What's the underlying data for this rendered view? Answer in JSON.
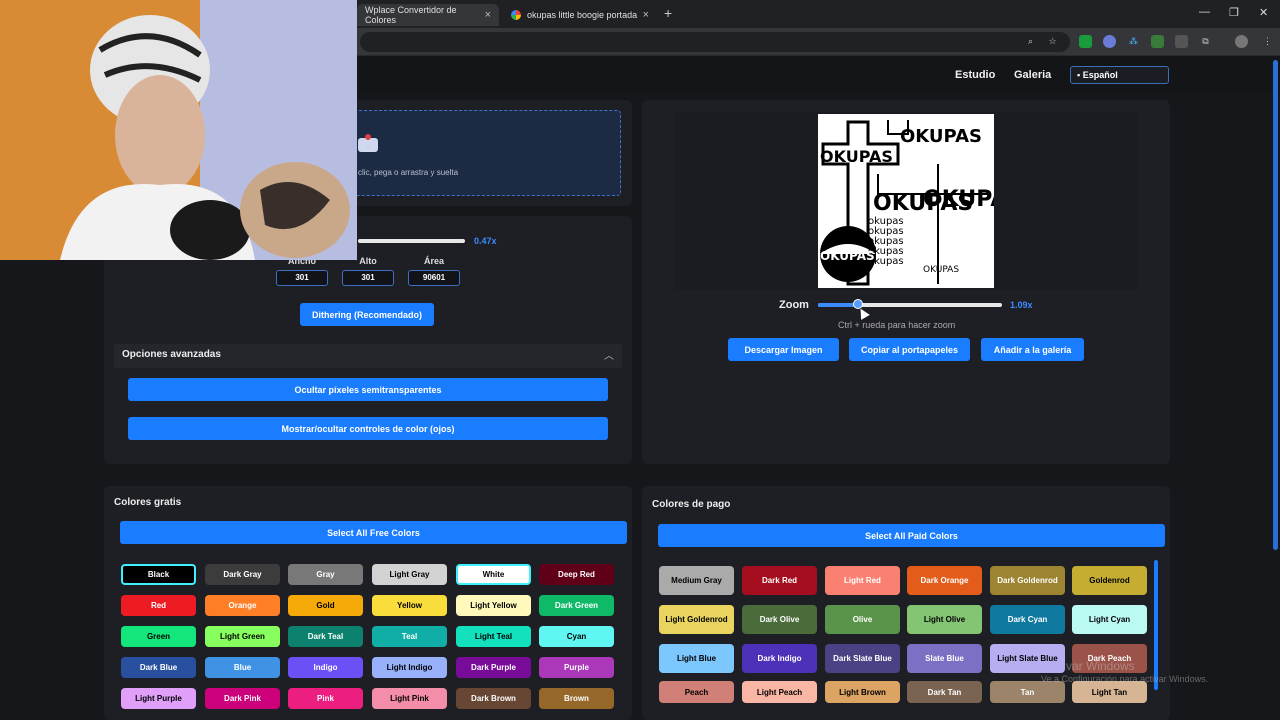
{
  "browser": {
    "tabs": [
      {
        "label": "Wplace Convertidor de Colores",
        "active": true
      },
      {
        "label": "okupas little boogie portada - I",
        "active": false
      }
    ],
    "new_tab": "+",
    "close": "×",
    "window_controls": [
      "—",
      "❐",
      "✕"
    ]
  },
  "header": {
    "nav": [
      "Estudio",
      "Galeria"
    ],
    "language": "Español"
  },
  "upload": {
    "hint": "clic, pega o arrastra y suelta"
  },
  "scale": {
    "value_label": "0.47x"
  },
  "dimensions": {
    "width_label": "Ancho",
    "height_label": "Alto",
    "area_label": "Área",
    "width": "301",
    "height": "301",
    "area": "90601"
  },
  "dithering_button": "Dithering (Recomendado)",
  "advanced": {
    "title": "Opciones avanzadas",
    "chevron": "︿",
    "hide_transparent": "Ocultar píxeles semitransparentes",
    "toggle_eyes": "Mostrar/ocultar controles de color (ojos)"
  },
  "preview": {
    "zoom_label": "Zoom",
    "zoom_value": "1.09x",
    "zoom_fraction": 0.22,
    "zoom_hint": "Ctrl + rueda para hacer zoom",
    "artwork_words": [
      "OKUPAS",
      "OKUPAS",
      "OKUPAS",
      "OKUPAS",
      "okupas",
      "okupas",
      "okupas",
      "okupas",
      "okupas",
      "OKUPAS",
      "OKUPAS"
    ],
    "buttons": {
      "download": "Descargar Imagen",
      "copy": "Copiar al portapapeles",
      "add_gallery": "Añadir a la galería"
    }
  },
  "free_colors": {
    "title": "Colores gratis",
    "select_all": "Select All Free Colors",
    "items": [
      {
        "label": "Black",
        "bg": "#000000",
        "fg": "#ffffff",
        "selected": true
      },
      {
        "label": "Dark Gray",
        "bg": "#3c3c3c",
        "fg": "#ffffff"
      },
      {
        "label": "Gray",
        "bg": "#787878",
        "fg": "#ffffff"
      },
      {
        "label": "Light Gray",
        "bg": "#d2d2d2",
        "fg": "#000000"
      },
      {
        "label": "White",
        "bg": "#ffffff",
        "fg": "#000000",
        "selected": true
      },
      {
        "label": "Deep Red",
        "bg": "#600018",
        "fg": "#ffffff"
      },
      {
        "label": "Red",
        "bg": "#ed1c24",
        "fg": "#ffffff"
      },
      {
        "label": "Orange",
        "bg": "#ff7f27",
        "fg": "#ffffff"
      },
      {
        "label": "Gold",
        "bg": "#f6aa09",
        "fg": "#000000"
      },
      {
        "label": "Yellow",
        "bg": "#f9dd3b",
        "fg": "#000000"
      },
      {
        "label": "Light Yellow",
        "bg": "#fffabc",
        "fg": "#000000"
      },
      {
        "label": "Dark Green",
        "bg": "#0eb968",
        "fg": "#ffffff"
      },
      {
        "label": "Green",
        "bg": "#13e67b",
        "fg": "#000000"
      },
      {
        "label": "Light Green",
        "bg": "#87ff5e",
        "fg": "#000000"
      },
      {
        "label": "Dark Teal",
        "bg": "#0c816e",
        "fg": "#ffffff"
      },
      {
        "label": "Teal",
        "bg": "#10aea6",
        "fg": "#ffffff"
      },
      {
        "label": "Light Teal",
        "bg": "#13e1be",
        "fg": "#000000"
      },
      {
        "label": "Cyan",
        "bg": "#60f7f2",
        "fg": "#000000"
      },
      {
        "label": "Dark Blue",
        "bg": "#28509e",
        "fg": "#ffffff"
      },
      {
        "label": "Blue",
        "bg": "#4093e4",
        "fg": "#ffffff"
      },
      {
        "label": "Indigo",
        "bg": "#6b50f6",
        "fg": "#ffffff"
      },
      {
        "label": "Light Indigo",
        "bg": "#99b1fb",
        "fg": "#000000"
      },
      {
        "label": "Dark Purple",
        "bg": "#780c99",
        "fg": "#ffffff"
      },
      {
        "label": "Purple",
        "bg": "#aa38b9",
        "fg": "#ffffff"
      },
      {
        "label": "Light Purple",
        "bg": "#e09ff9",
        "fg": "#000000"
      },
      {
        "label": "Dark Pink",
        "bg": "#cb007a",
        "fg": "#ffffff"
      },
      {
        "label": "Pink",
        "bg": "#ec1f80",
        "fg": "#ffffff"
      },
      {
        "label": "Light Pink",
        "bg": "#f38da9",
        "fg": "#000000"
      },
      {
        "label": "Dark Brown",
        "bg": "#684634",
        "fg": "#ffffff"
      },
      {
        "label": "Brown",
        "bg": "#95682a",
        "fg": "#ffffff"
      }
    ]
  },
  "paid_colors": {
    "title": "Colores de pago",
    "select_all": "Select All Paid Colors",
    "items": [
      {
        "label": "Medium Gray",
        "bg": "#aaaaaa",
        "fg": "#000000"
      },
      {
        "label": "Dark Red",
        "bg": "#a50e1e",
        "fg": "#ffffff"
      },
      {
        "label": "Light Red",
        "bg": "#fa8072",
        "fg": "#ffffff"
      },
      {
        "label": "Dark Orange",
        "bg": "#e45c1a",
        "fg": "#ffffff"
      },
      {
        "label": "Dark Goldenrod",
        "bg": "#9c8431",
        "fg": "#ffffff"
      },
      {
        "label": "Goldenrod",
        "bg": "#c5ad31",
        "fg": "#000000"
      },
      {
        "label": "Light Goldenrod",
        "bg": "#e8d45f",
        "fg": "#000000"
      },
      {
        "label": "Dark Olive",
        "bg": "#4a6b3a",
        "fg": "#ffffff"
      },
      {
        "label": "Olive",
        "bg": "#5a944a",
        "fg": "#ffffff"
      },
      {
        "label": "Light Olive",
        "bg": "#84c573",
        "fg": "#000000"
      },
      {
        "label": "Dark Cyan",
        "bg": "#0f799f",
        "fg": "#ffffff"
      },
      {
        "label": "Light Cyan",
        "bg": "#bbfaf2",
        "fg": "#000000"
      },
      {
        "label": "Light Blue",
        "bg": "#7dc7ff",
        "fg": "#000000"
      },
      {
        "label": "Dark Indigo",
        "bg": "#4d31b8",
        "fg": "#ffffff"
      },
      {
        "label": "Dark Slate Blue",
        "bg": "#4a4284",
        "fg": "#ffffff"
      },
      {
        "label": "Slate Blue",
        "bg": "#7a71c4",
        "fg": "#ffffff"
      },
      {
        "label": "Light Slate Blue",
        "bg": "#b5aef1",
        "fg": "#000000"
      },
      {
        "label": "Dark Peach",
        "bg": "#9b5249",
        "fg": "#ffffff"
      },
      {
        "label": "Peach",
        "bg": "#d18078",
        "fg": "#000000"
      },
      {
        "label": "Light Peach",
        "bg": "#fab6a4",
        "fg": "#000000"
      },
      {
        "label": "Light Brown",
        "bg": "#dba463",
        "fg": "#000000"
      },
      {
        "label": "Dark Tan",
        "bg": "#7b6352",
        "fg": "#ffffff"
      },
      {
        "label": "Tan",
        "bg": "#9c846b",
        "fg": "#ffffff"
      },
      {
        "label": "Light Tan",
        "bg": "#d6b594",
        "fg": "#000000"
      }
    ]
  },
  "watermark": {
    "line1": "var Windows",
    "line2": "Ve a Configuración para activar Windows."
  }
}
